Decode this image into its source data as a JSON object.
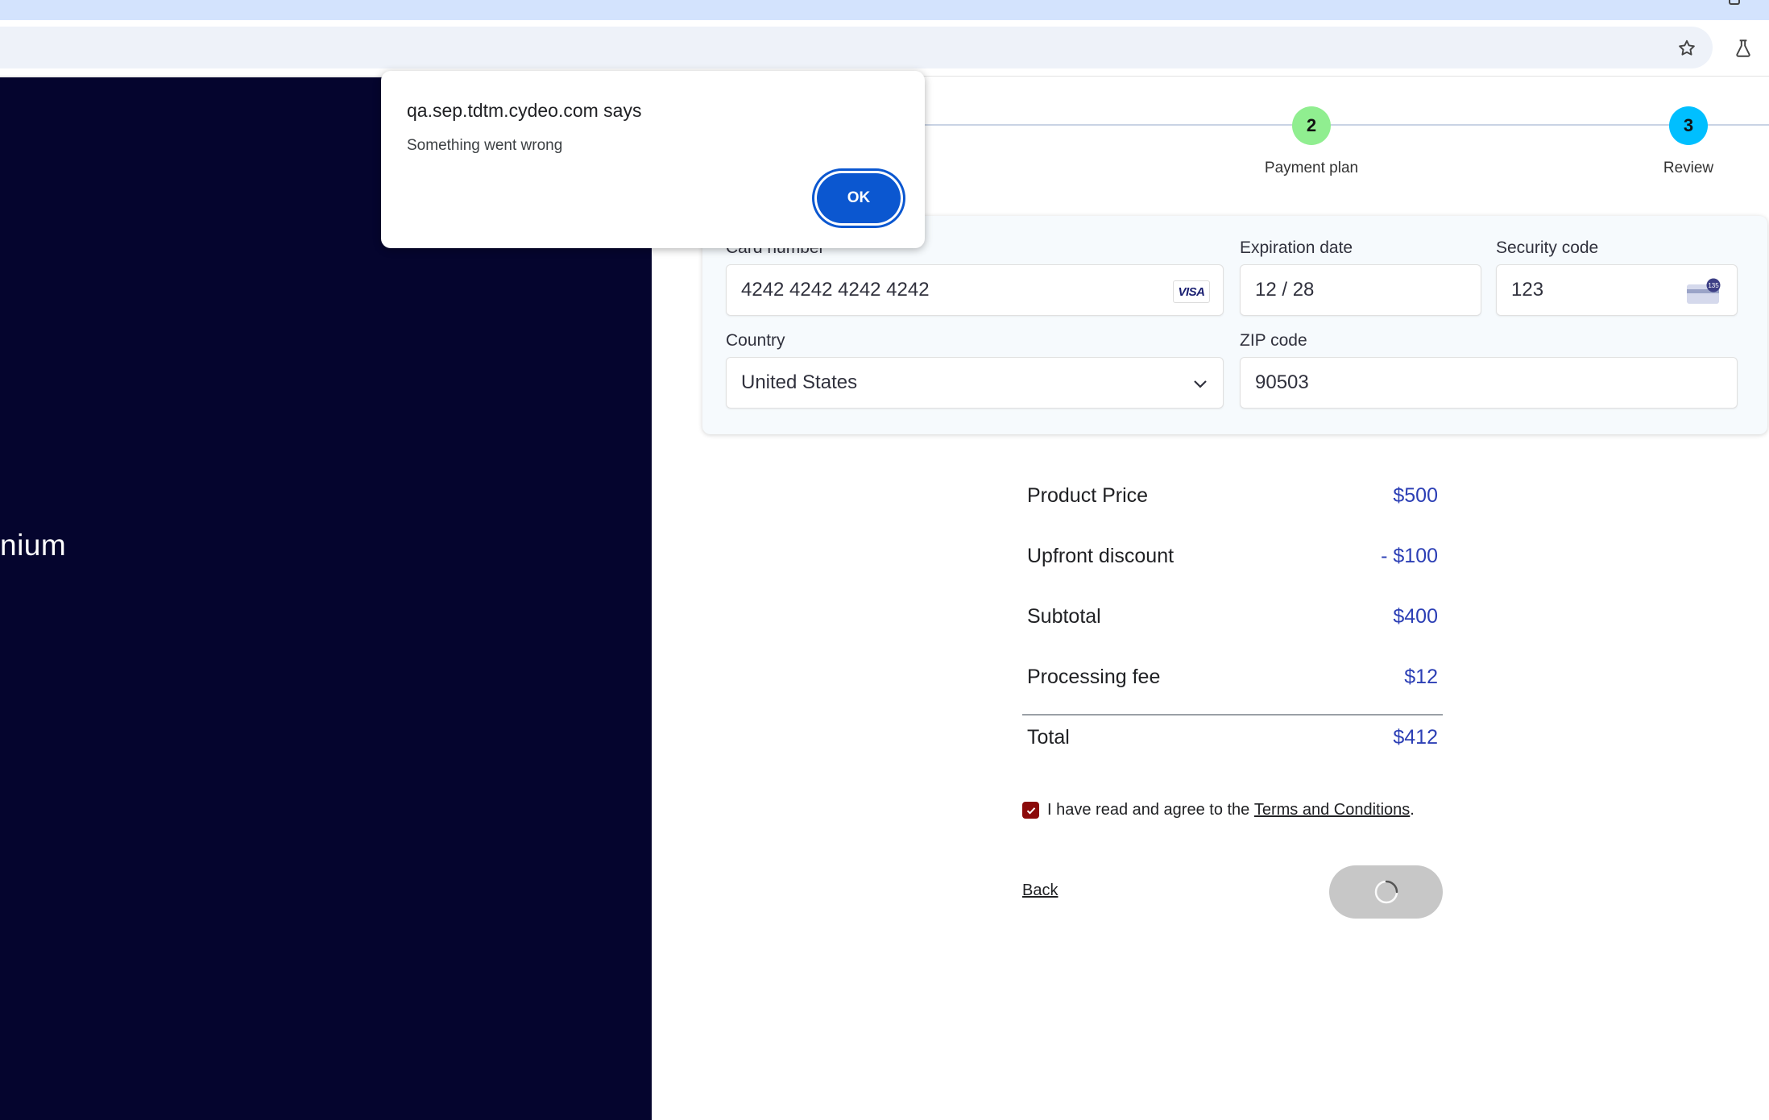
{
  "browser": {
    "star_icon": "star-icon",
    "labs_icon": "flask-icon"
  },
  "left_panel": {
    "plan_name": "nium"
  },
  "stepper": {
    "steps": [
      {
        "number": "2",
        "label": "Payment plan",
        "color": "#90ee90"
      },
      {
        "number": "3",
        "label": "Review",
        "color": "#00bfff"
      }
    ]
  },
  "payment": {
    "card_number_label": "Card number",
    "card_number_value": "4242 4242 4242 4242",
    "card_brand": "VISA",
    "expiration_label": "Expiration date",
    "expiration_value": "12 / 28",
    "security_label": "Security code",
    "security_value": "123",
    "cvc_badge": "135",
    "country_label": "Country",
    "country_value": "United States",
    "zip_label": "ZIP code",
    "zip_value": "90503"
  },
  "summary": {
    "rows": [
      {
        "label": "Product Price",
        "value": "$500"
      },
      {
        "label": "Upfront discount",
        "value": "- $100"
      },
      {
        "label": "Subtotal",
        "value": "$400"
      },
      {
        "label": "Processing fee",
        "value": "$12"
      }
    ],
    "total_label": "Total",
    "total_value": "$412"
  },
  "agreement": {
    "text_prefix": "I have read and agree to the ",
    "link_text": "Terms and Conditions",
    "text_suffix": ".",
    "checked": true
  },
  "actions": {
    "back_label": "Back"
  },
  "dialog": {
    "title": "qa.sep.tdtm.cydeo.com says",
    "message": "Something went wrong",
    "ok_label": "OK"
  },
  "colors": {
    "accent_blue": "#0b57d0",
    "left_panel_bg": "#05052e",
    "price_blue": "#2c3fb5",
    "checkbox_red": "#8b0a0a"
  }
}
